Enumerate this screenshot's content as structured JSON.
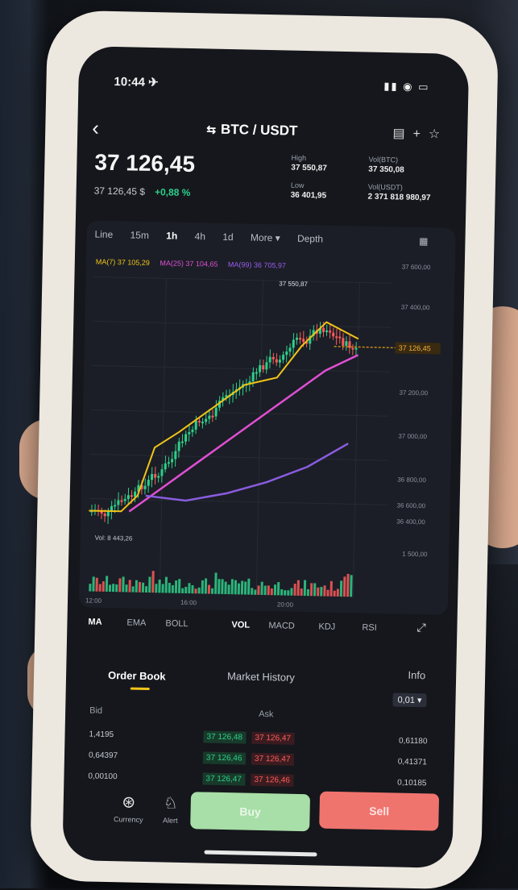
{
  "status_bar": {
    "time": "10:44 ✈",
    "signal": "▮▮ ◉ ▭"
  },
  "header": {
    "pair": "BTC / USDT",
    "price": "37 126,45",
    "sub_price": "37 126,45 $",
    "change": "+0,88 %",
    "stats": [
      {
        "label": "High",
        "value": "37 550,87"
      },
      {
        "label": "Vol(BTC)",
        "value": "37 350,08"
      },
      {
        "label": "Low",
        "value": "36 401,95"
      },
      {
        "label": "Vol(USDT)",
        "value": "2 371 818 980,97"
      }
    ]
  },
  "chart_tabs": [
    "Line",
    "15m",
    "1h",
    "4h",
    "1d",
    "More ▾",
    "Depth"
  ],
  "chart_tabs_active": "1h",
  "legend": [
    {
      "text": "MA(7) 37 105,29",
      "color": "#f0c419"
    },
    {
      "text": "MA(25) 37 104,65",
      "color": "#e04fd4"
    },
    {
      "text": "MA(99) 36 705,97",
      "color": "#9b5cf0"
    }
  ],
  "chart_annotations": {
    "high_label": "37 550,87",
    "current_label": "37 126,45",
    "vol_label": "Vol: 8 443,26"
  },
  "chart_data": {
    "type": "line",
    "y_ticks": [
      "37 600,00",
      "37 400,00",
      "37 200,00",
      "37 000,00",
      "36 800,00",
      "36 600,00",
      "36 400,00"
    ],
    "vol_tick": "1 500,00",
    "x_ticks": [
      "12:00",
      "16:00",
      "20:00"
    ]
  },
  "indicators": [
    {
      "label": "MA",
      "on": true
    },
    {
      "label": "EMA"
    },
    {
      "label": "BOLL"
    },
    {
      "label": "VOL",
      "on": true
    },
    {
      "label": "MACD"
    },
    {
      "label": "KDJ"
    },
    {
      "label": "RSI"
    }
  ],
  "order_book": {
    "tabs": [
      "Order Book",
      "Market History",
      "Info"
    ],
    "precision": "0,01 ▾",
    "bid_label": "Bid",
    "ask_label": "Ask",
    "rows": [
      {
        "bid_qty": "1,4195",
        "bid": "37 126,48",
        "ask": "37 126,47",
        "ask_qty": "0,61180"
      },
      {
        "bid_qty": "0,64397",
        "bid": "37 126,46",
        "ask": "37 126,47",
        "ask_qty": "0,41371"
      },
      {
        "bid_qty": "0,00100",
        "bid": "37 126,47",
        "ask": "37 126,46",
        "ask_qty": "0,10185"
      }
    ]
  },
  "bottom": {
    "left_icons": [
      {
        "label": "Currency",
        "glyph": "⊛"
      },
      {
        "label": "Alert",
        "glyph": "♘"
      }
    ],
    "buy": "Buy",
    "sell": "Sell"
  }
}
